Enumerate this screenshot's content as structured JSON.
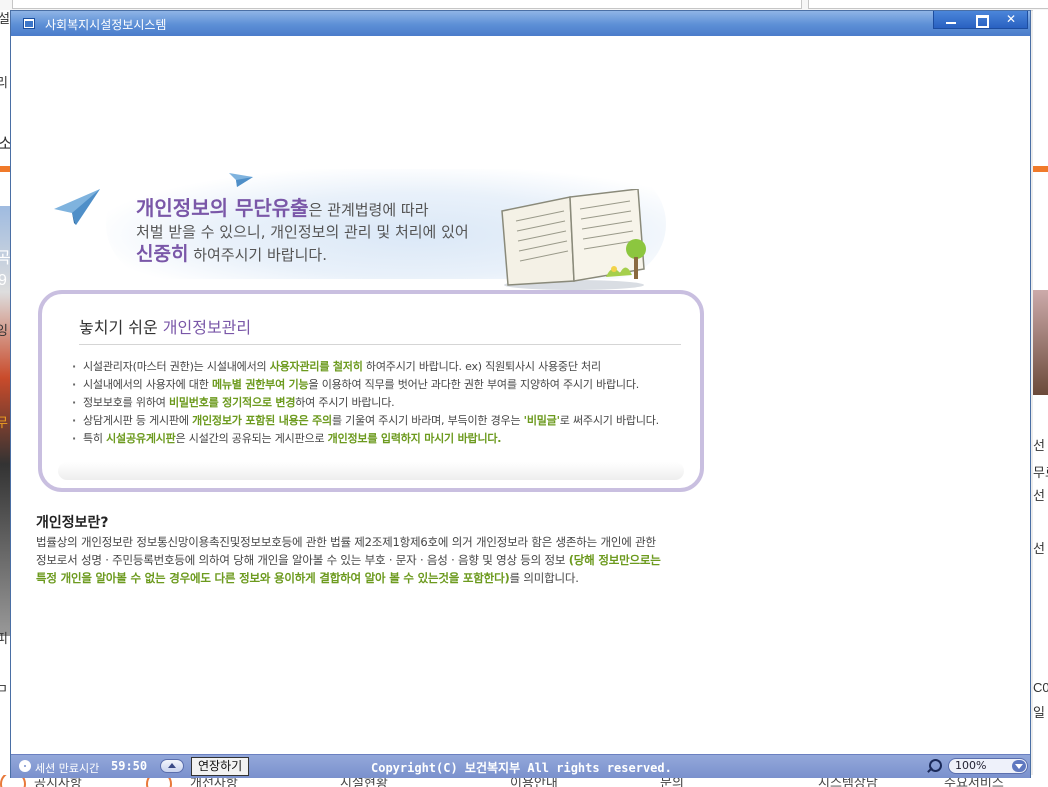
{
  "background": {
    "left_fragments": [
      "설",
      "리",
      "소",
      "곡",
      "9",
      "잉",
      "무",
      "피",
      "ㅁ"
    ],
    "right_fragments": [
      "선",
      "무료",
      "선",
      "선",
      "C0",
      "일"
    ],
    "bottom_fragments": [
      "공지사항",
      "개선사항",
      "시설현황",
      "이용안내",
      "문의",
      "시스템상담",
      "주요서비스"
    ]
  },
  "window": {
    "title": "사회복지시설정보시스템",
    "controls": {
      "minimize": "",
      "maximize": "",
      "close": "✕"
    }
  },
  "banner": {
    "highlight1": "개인정보의 무단유출",
    "text1": "은 관계법령에 따라",
    "text2": "처벌 받을 수 있으니, 개인정보의 관리 및 처리에 있어",
    "highlight2": "신중히",
    "text3": " 하여주시기 바랍니다."
  },
  "box": {
    "title_prefix": "놓치기 쉬운 ",
    "title_highlight": "개인정보관리",
    "bullets": [
      {
        "a": "시설관리자(마스터 권한)는 시설내에서의 ",
        "g": "사용자관리를 철저히",
        "b": " 하여주시기 바랍니다. ex) 직원퇴사시 사용중단 처리",
        "g2": "",
        "c": ""
      },
      {
        "a": "시설내에서의 사용자에 대한 ",
        "g": "메뉴별 권한부여 기능",
        "b": "을 이용하여 직무를 벗어난 과다한 권한 부여를 지양하여 주시기 바랍니다.",
        "g2": "",
        "c": ""
      },
      {
        "a": "정보보호를 위하여 ",
        "g": "비밀번호를 정기적으로 변경",
        "b": "하여 주시기 바랍니다.",
        "g2": "",
        "c": ""
      },
      {
        "a": "상담게시판 등 게시판에 ",
        "g": "개인정보가 포함된 내용은 주의",
        "b": "를 기울여 주시기 바라며, 부득이한 경우는 ",
        "g2": "'비밀글'",
        "c": "로 써주시기 바랍니다."
      },
      {
        "a": "특히 ",
        "g": "시설공유게시판",
        "b": "은 시설간의 공유되는 게시판으로 ",
        "g2": "개인정보를 입력하지 마시기 바랍니다.",
        "c": ""
      }
    ]
  },
  "definition": {
    "title": "개인정보란?",
    "line1": "법률상의 개인정보란 정보통신망이용촉진및정보보호등에 관한 법률 제2조제1항제6호에 의거 개인정보라 함은 생존하는 개인에 관한",
    "line2_plain": "정보로서 성명 · 주민등록번호등에 의하여 당해 개인을 알아볼 수 있는 부호 · 문자 · 음성 · 음향 및 영상 등의 정보 ",
    "line2_green": "(당해 정보만으로는",
    "line3_green": "특정 개인을 알아볼 수 없는 경우에도 다른 정보와 용이하게 결합하여 알아 볼 수 있는것을 포함한다)",
    "line3_plain": "를 의미합니다."
  },
  "statusbar": {
    "session_label": "세션 만료시간",
    "session_time": "59:50",
    "extend_label": "연장하기",
    "copyright": "Copyright(C) 보건복지부 All rights reserved.",
    "zoom_value": "100%"
  },
  "colors": {
    "title_bar": "#5c8fd6",
    "accent_purple": "#7a57a8",
    "accent_green": "#6c9a1e",
    "status_bar": "#7a91cd"
  },
  "icons": {
    "window": "window-icon",
    "plane": "paper-plane-icon",
    "book": "open-book-icon",
    "gear": "gear-icon",
    "zoom": "magnifier-icon"
  }
}
